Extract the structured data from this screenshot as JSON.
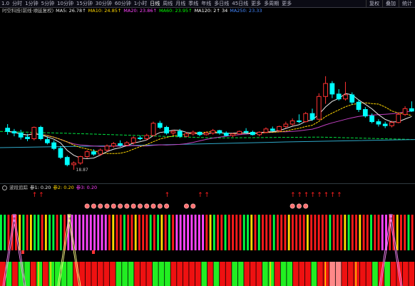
{
  "toolbar": {
    "left_items": [
      "1.0",
      "分时",
      "1分钟",
      "5分钟",
      "10分钟",
      "15分钟",
      "30分钟",
      "60分钟",
      "1小时",
      "日线",
      "周线",
      "月线",
      "季线",
      "年线",
      "多日线",
      "45日线",
      "更多",
      "多周期",
      "更多"
    ],
    "active_index": 9,
    "right_items": [
      "复权",
      "叠加",
      "统计"
    ]
  },
  "main_legend": {
    "items": [
      {
        "text": "时空科技(前线·顺延复权)",
        "color": "#c0c0c0"
      },
      {
        "text": "MA5: 26.78↑",
        "color": "#e8e8e8"
      },
      {
        "text": "MA10: 24.85↑",
        "color": "#ffd700"
      },
      {
        "text": "MA20: 23.86↑",
        "color": "#ff44ff"
      },
      {
        "text": "MA60: 23.95↑",
        "color": "#00ff00"
      },
      {
        "text": "MA120: 2↑ 34",
        "color": "#ffffff"
      },
      {
        "text": "MA250: 23.33",
        "color": "#4488ff"
      }
    ]
  },
  "low_label": "18.87",
  "indicator_legend": {
    "items": [
      {
        "text": "波段追踪",
        "color": "#c0c0c0"
      },
      {
        "text": "参1: 0.20",
        "color": "#e8e8e8"
      },
      {
        "text": "参2: 0.20",
        "color": "#ffd700"
      },
      {
        "text": "参3: 0.20",
        "color": "#ff44ff"
      }
    ]
  },
  "colors": {
    "up": "#ff3333",
    "down": "#00ffff",
    "ma5": "#e8e8e8",
    "ma10": "#ffd700",
    "ma20": "#c040c0",
    "ma60": "#00e040",
    "ma120": "#2fa8c8",
    "arrow": "#ff2020"
  },
  "candles": [
    {
      "o": 24.0,
      "h": 24.5,
      "l": 23.2,
      "c": 23.6
    },
    {
      "o": 23.6,
      "h": 23.9,
      "l": 23.0,
      "c": 23.4
    },
    {
      "o": 23.4,
      "h": 23.8,
      "l": 22.6,
      "c": 22.9
    },
    {
      "o": 22.9,
      "h": 23.3,
      "l": 22.4,
      "c": 22.7
    },
    {
      "o": 22.7,
      "h": 24.2,
      "l": 22.5,
      "c": 24.1
    },
    {
      "o": 24.1,
      "h": 24.3,
      "l": 22.5,
      "c": 22.7
    },
    {
      "o": 22.6,
      "h": 22.9,
      "l": 22.0,
      "c": 22.2
    },
    {
      "o": 22.2,
      "h": 22.5,
      "l": 21.3,
      "c": 21.5
    },
    {
      "o": 21.5,
      "h": 21.8,
      "l": 20.2,
      "c": 20.4
    },
    {
      "o": 20.4,
      "h": 20.6,
      "l": 19.3,
      "c": 19.5
    },
    {
      "o": 19.5,
      "h": 19.9,
      "l": 18.87,
      "c": 19.7
    },
    {
      "o": 19.7,
      "h": 20.6,
      "l": 19.5,
      "c": 20.5
    },
    {
      "o": 20.5,
      "h": 21.3,
      "l": 20.3,
      "c": 21.1
    },
    {
      "o": 21.1,
      "h": 21.4,
      "l": 20.6,
      "c": 20.8
    },
    {
      "o": 20.8,
      "h": 21.5,
      "l": 20.6,
      "c": 21.3
    },
    {
      "o": 21.3,
      "h": 22.0,
      "l": 21.1,
      "c": 21.8
    },
    {
      "o": 21.8,
      "h": 22.3,
      "l": 21.6,
      "c": 22.1
    },
    {
      "o": 22.1,
      "h": 22.5,
      "l": 21.7,
      "c": 21.9
    },
    {
      "o": 21.9,
      "h": 22.4,
      "l": 21.8,
      "c": 22.2
    },
    {
      "o": 22.2,
      "h": 23.0,
      "l": 22.0,
      "c": 22.8
    },
    {
      "o": 22.8,
      "h": 23.1,
      "l": 22.5,
      "c": 22.7
    },
    {
      "o": 22.7,
      "h": 23.3,
      "l": 22.5,
      "c": 23.1
    },
    {
      "o": 23.1,
      "h": 24.8,
      "l": 23.0,
      "c": 24.6
    },
    {
      "o": 24.6,
      "h": 24.9,
      "l": 23.9,
      "c": 24.1
    },
    {
      "o": 24.1,
      "h": 24.3,
      "l": 23.2,
      "c": 23.4
    },
    {
      "o": 23.4,
      "h": 23.8,
      "l": 23.1,
      "c": 23.6
    },
    {
      "o": 23.6,
      "h": 23.9,
      "l": 22.8,
      "c": 23.0
    },
    {
      "o": 23.0,
      "h": 23.5,
      "l": 22.9,
      "c": 23.3
    },
    {
      "o": 23.3,
      "h": 23.7,
      "l": 23.1,
      "c": 23.5
    },
    {
      "o": 23.5,
      "h": 23.6,
      "l": 23.0,
      "c": 23.2
    },
    {
      "o": 23.2,
      "h": 23.6,
      "l": 23.1,
      "c": 23.4
    },
    {
      "o": 23.4,
      "h": 23.9,
      "l": 23.2,
      "c": 23.7
    },
    {
      "o": 23.7,
      "h": 23.8,
      "l": 23.2,
      "c": 23.4
    },
    {
      "o": 23.4,
      "h": 23.6,
      "l": 23.0,
      "c": 23.1
    },
    {
      "o": 23.1,
      "h": 23.4,
      "l": 22.9,
      "c": 23.3
    },
    {
      "o": 23.3,
      "h": 23.7,
      "l": 23.2,
      "c": 23.6
    },
    {
      "o": 23.6,
      "h": 24.0,
      "l": 23.3,
      "c": 23.5
    },
    {
      "o": 23.5,
      "h": 23.7,
      "l": 23.1,
      "c": 23.2
    },
    {
      "o": 23.2,
      "h": 23.6,
      "l": 23.0,
      "c": 23.5
    },
    {
      "o": 23.5,
      "h": 24.1,
      "l": 23.4,
      "c": 23.9
    },
    {
      "o": 23.9,
      "h": 24.2,
      "l": 23.6,
      "c": 23.7
    },
    {
      "o": 23.7,
      "h": 24.3,
      "l": 23.6,
      "c": 24.2
    },
    {
      "o": 24.2,
      "h": 24.8,
      "l": 24.0,
      "c": 24.5
    },
    {
      "o": 24.5,
      "h": 25.2,
      "l": 24.3,
      "c": 24.9
    },
    {
      "o": 24.9,
      "h": 25.7,
      "l": 24.6,
      "c": 24.8
    },
    {
      "o": 24.8,
      "h": 26.0,
      "l": 24.7,
      "c": 25.8
    },
    {
      "o": 25.8,
      "h": 26.4,
      "l": 24.9,
      "c": 25.1
    },
    {
      "o": 25.1,
      "h": 28.3,
      "l": 25.0,
      "c": 27.9
    },
    {
      "o": 27.9,
      "h": 30.4,
      "l": 27.0,
      "c": 29.5
    },
    {
      "o": 29.5,
      "h": 29.8,
      "l": 27.7,
      "c": 28.2
    },
    {
      "o": 28.2,
      "h": 28.8,
      "l": 27.4,
      "c": 27.6
    },
    {
      "o": 27.6,
      "h": 29.7,
      "l": 27.4,
      "c": 28.1
    },
    {
      "o": 28.1,
      "h": 28.4,
      "l": 26.9,
      "c": 27.2
    },
    {
      "o": 27.2,
      "h": 27.5,
      "l": 26.0,
      "c": 26.3
    },
    {
      "o": 26.3,
      "h": 26.6,
      "l": 25.3,
      "c": 25.5
    },
    {
      "o": 25.5,
      "h": 25.8,
      "l": 24.6,
      "c": 24.8
    },
    {
      "o": 24.8,
      "h": 25.1,
      "l": 24.2,
      "c": 24.5
    },
    {
      "o": 24.5,
      "h": 24.8,
      "l": 24.0,
      "c": 24.3
    },
    {
      "o": 24.3,
      "h": 24.9,
      "l": 24.1,
      "c": 24.7
    },
    {
      "o": 24.7,
      "h": 25.9,
      "l": 24.6,
      "c": 25.7
    },
    {
      "o": 25.7,
      "h": 26.7,
      "l": 25.5,
      "c": 26.4
    },
    {
      "o": 26.4,
      "h": 27.3,
      "l": 26.0,
      "c": 26.1
    }
  ],
  "arrows_top": [
    4,
    5,
    24,
    29,
    30,
    43,
    44,
    45,
    46,
    47,
    48,
    49,
    50
  ],
  "dots": [
    12,
    13,
    14,
    15,
    16,
    17,
    18,
    19,
    20,
    21,
    22,
    23,
    24,
    27,
    28,
    43,
    44,
    45
  ],
  "bar_colors": "GGRRRYGRYGGRYGGRGRMMMMMMMMMMMRYRRGRRYRRRGRGYRGRMMMMMMMMRYGRRGRRRRGGYRGRRRGRRRYRRRRYRRRRRGRRRYGRRYRRGRRMMRRYRRGR",
  "bottom_colors": "RGRGGRGRGGGGRRRRRRRGGGRRRGGGRRRRRGRGRRGGRRRGGRGGRRRGRRPPRRRRRGRGRRRR"
}
